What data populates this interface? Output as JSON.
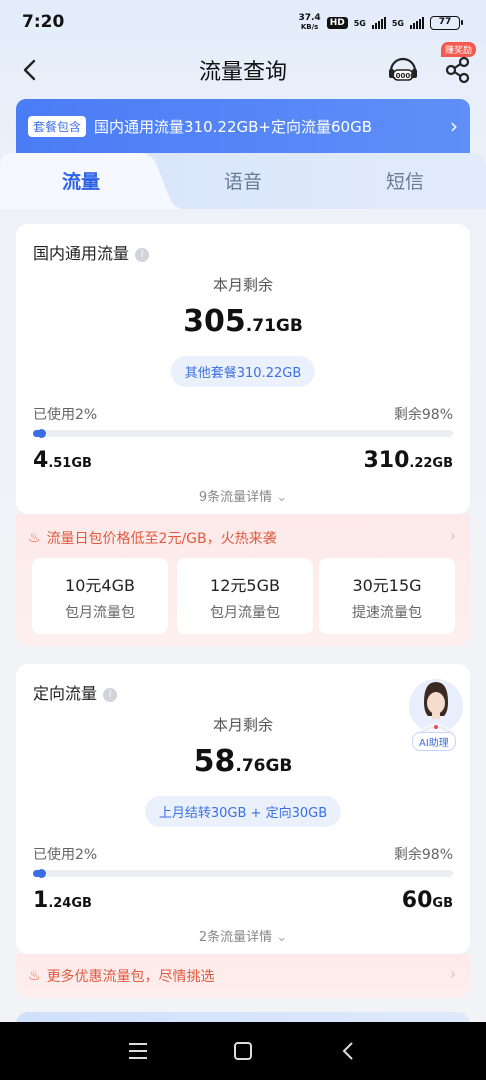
{
  "status_bar": {
    "time": "7:20",
    "net_speed_value": "37.4",
    "net_speed_unit": "KB/s",
    "hd": "HD",
    "sig1_label": "5G",
    "sig2_label": "5G",
    "battery": "77"
  },
  "nav": {
    "title": "流量查询",
    "service_label": "10000",
    "reward_badge": "赚奖励"
  },
  "plan_banner": {
    "tag": "套餐包含",
    "text": "国内通用流量310.22GB+定向流量60GB"
  },
  "tabs": [
    {
      "label": "流量",
      "active": true
    },
    {
      "label": "语音",
      "active": false
    },
    {
      "label": "短信",
      "active": false
    }
  ],
  "general_card": {
    "title": "国内通用流量",
    "remain_label": "本月剩余",
    "remain_big": "305",
    "remain_small": ".71GB",
    "chip": "其他套餐310.22GB",
    "used_label": "已使用2%",
    "left_label": "剩余98%",
    "used_fraction": 0.02,
    "used_big": "4",
    "used_small": ".51GB",
    "total_big": "310",
    "total_small": ".22GB",
    "details": "9条流量详情"
  },
  "promo": {
    "text": "流量日包价格低至2元/GB，火热来袭",
    "packs": [
      {
        "name": "10元4GB",
        "desc": "包月流量包"
      },
      {
        "name": "12元5GB",
        "desc": "包月流量包"
      },
      {
        "name": "30元15G",
        "desc": "提速流量包"
      }
    ]
  },
  "directed_card": {
    "title": "定向流量",
    "ai_label": "AI助理",
    "remain_label": "本月剩余",
    "remain_big": "58",
    "remain_small": ".76GB",
    "chip": "上月结转30GB + 定向30GB",
    "used_label": "已使用2%",
    "left_label": "剩余98%",
    "used_fraction": 0.02,
    "used_big": "1",
    "used_small": ".24GB",
    "total_big": "60",
    "total_small": "GB",
    "details": "2条流量详情"
  },
  "promo2": {
    "text": "更多优惠流量包，尽情挑选"
  },
  "colors": {
    "accent": "#3a6ce8",
    "promo_text": "#e25a3d",
    "banner": "#4a7cf6"
  }
}
